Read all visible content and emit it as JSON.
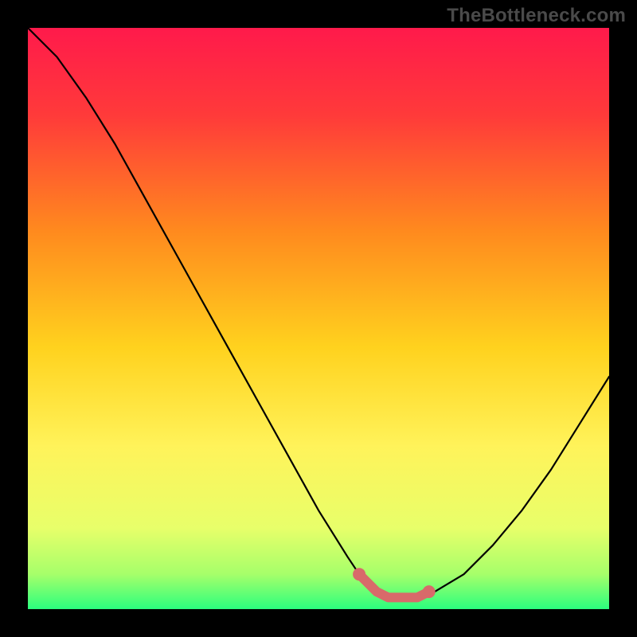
{
  "watermark": "TheBottleneck.com",
  "chart_data": {
    "type": "line",
    "title": "",
    "xlabel": "",
    "ylabel": "",
    "xlim": [
      0,
      100
    ],
    "ylim": [
      0,
      100
    ],
    "series": [
      {
        "name": "bottleneck-curve",
        "x": [
          0,
          5,
          10,
          15,
          20,
          25,
          30,
          35,
          40,
          45,
          50,
          55,
          57,
          60,
          62,
          65,
          67,
          70,
          75,
          80,
          85,
          90,
          95,
          100
        ],
        "values": [
          100,
          95,
          88,
          80,
          71,
          62,
          53,
          44,
          35,
          26,
          17,
          9,
          6,
          3,
          2,
          2,
          2,
          3,
          6,
          11,
          17,
          24,
          32,
          40
        ]
      }
    ],
    "highlight": {
      "name": "optimal-range",
      "x": [
        57,
        60,
        62,
        65,
        67,
        69
      ],
      "values": [
        6,
        3,
        2,
        2,
        2,
        3
      ]
    },
    "gradient_stops": [
      {
        "offset": 0.0,
        "color": "#ff1a4b"
      },
      {
        "offset": 0.15,
        "color": "#ff3a3a"
      },
      {
        "offset": 0.35,
        "color": "#ff8a1e"
      },
      {
        "offset": 0.55,
        "color": "#ffd21e"
      },
      {
        "offset": 0.72,
        "color": "#fff35a"
      },
      {
        "offset": 0.86,
        "color": "#e8ff6a"
      },
      {
        "offset": 0.94,
        "color": "#a6ff6a"
      },
      {
        "offset": 1.0,
        "color": "#2bff7e"
      }
    ],
    "highlight_color": "#d86a6a"
  }
}
